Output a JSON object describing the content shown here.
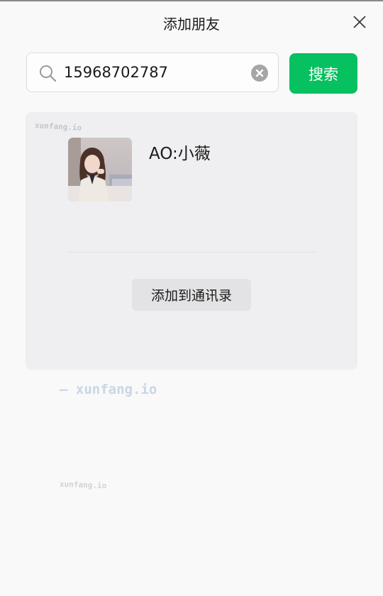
{
  "window": {
    "title": "添加朋友",
    "close_icon": "close-icon"
  },
  "search": {
    "icon": "search-icon",
    "value": "15968702787",
    "clear_icon": "clear-circle-icon",
    "button_label": "搜索",
    "button_color": "#07c160"
  },
  "result": {
    "avatar": "user-avatar-photo",
    "nickname": "AO:小薇",
    "add_button_label": "添加到通讯录"
  },
  "watermarks": {
    "card_top_left": "xunfang.io",
    "below_card": "— xunfang.io",
    "lower_left": "xunfang.io"
  }
}
